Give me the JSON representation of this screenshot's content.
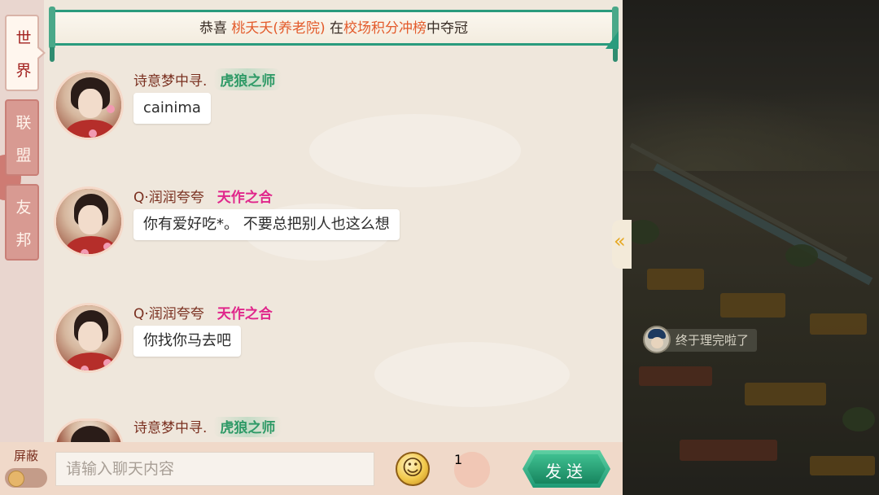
{
  "tabs": [
    {
      "label_top": "世",
      "label_bottom": "界",
      "active": true
    },
    {
      "label_top": "联",
      "label_bottom": "盟",
      "active": false
    },
    {
      "label_top": "友",
      "label_bottom": "邦",
      "active": false
    }
  ],
  "announcement": {
    "prefix": "恭喜",
    "player": "桃夭夭(养老院)",
    "mid": "在",
    "event": "校场积分冲榜",
    "suffix": "中夺冠"
  },
  "messages": [
    {
      "name": "诗意梦中寻.",
      "title": "虎狼之师",
      "text": "cainima"
    },
    {
      "name": "Q·润润夸夸",
      "title": "天作之合",
      "text": "你有爱好吃*。 不要总把别人也这么想"
    },
    {
      "name": "Q·润润夸夸",
      "title": "天作之合",
      "text": "你找你马去吧"
    },
    {
      "name": "诗意梦中寻.",
      "title": "虎狼之师",
      "text": ""
    }
  ],
  "scene": {
    "npc_speech": "终于理完啦了"
  },
  "bottom": {
    "mute_label": "屏蔽",
    "input_placeholder": "请输入聊天内容",
    "redpacket_count": "1",
    "send_label": "发送"
  },
  "colors": {
    "accent_green": "#2a9b7d",
    "highlight_orange": "#e35b2b",
    "name_brown": "#7a3020",
    "title_green": "#2f9a67",
    "title_pink": "#e0268b"
  }
}
